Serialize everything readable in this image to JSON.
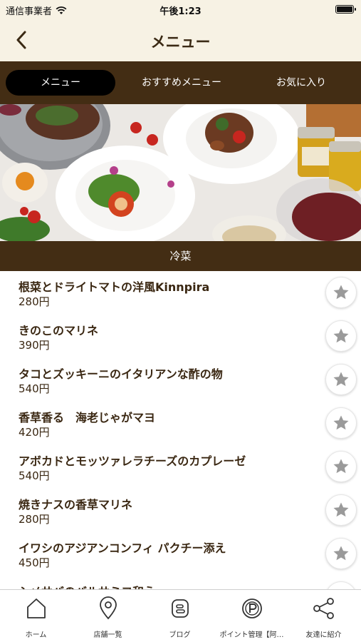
{
  "status_bar": {
    "carrier": "通信事業者",
    "time": "午後1:23"
  },
  "nav": {
    "title": "メニュー",
    "back_icon": "chevron-left-icon"
  },
  "tabs": [
    {
      "label": "メニュー",
      "active": true
    },
    {
      "label": "おすすめメニュー",
      "active": false
    },
    {
      "label": "お気に入り",
      "active": false
    }
  ],
  "section": {
    "title": "冷菜"
  },
  "menu_items": [
    {
      "name": "根菜とドライトマトの洋風Kinnpira",
      "price": "280円"
    },
    {
      "name": "きのこのマリネ",
      "price": "390円"
    },
    {
      "name": "タコとズッキーニのイタリアンな酢の物",
      "price": "540円"
    },
    {
      "name": "香草香る　海老じゃがマヨ",
      "price": "420円"
    },
    {
      "name": "アボカドとモッツァレラチーズのカプレーゼ",
      "price": "540円"
    },
    {
      "name": "焼きナスの香草マリネ",
      "price": "280円"
    },
    {
      "name": "イワシのアジアンコンフィ パクチー添え",
      "price": "450円"
    },
    {
      "name": "シメサバのバルサミコ和え",
      "price": ""
    }
  ],
  "bottom_nav": [
    {
      "label": "ホーム",
      "icon": "home-icon"
    },
    {
      "label": "店舗一覧",
      "icon": "map-pin-icon"
    },
    {
      "label": "ブログ",
      "icon": "blog-icon"
    },
    {
      "label": "ポイント管理【阿…",
      "icon": "points-icon"
    },
    {
      "label": "友達に紹介",
      "icon": "share-icon"
    }
  ],
  "colors": {
    "header_bg": "#f7f2e4",
    "brown": "#432d14",
    "text": "#3a2712",
    "star": "#9a9a9a"
  }
}
